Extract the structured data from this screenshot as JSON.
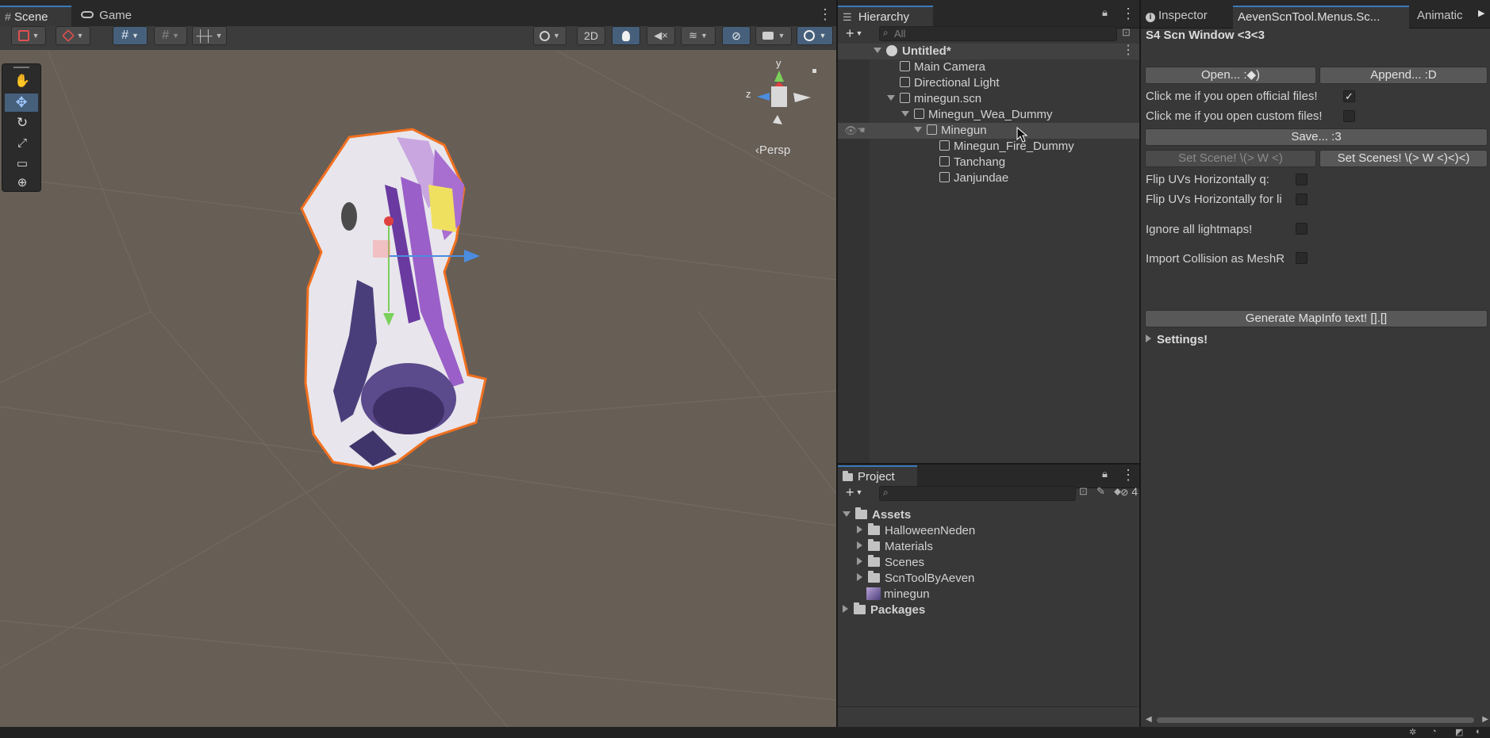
{
  "scene_window": {
    "tabs": [
      {
        "label": "Scene",
        "icon": "hash-icon"
      },
      {
        "label": "Game",
        "icon": "gamepad-icon"
      }
    ],
    "toolbar": {
      "mode_2d": "2D"
    },
    "tools": [
      "hand-tool",
      "move-tool",
      "rotate-tool",
      "scale-tool",
      "rect-tool",
      "transform-tool"
    ],
    "gizmo": {
      "axis_y": "y",
      "axis_z": "z",
      "projection": "‹Persp"
    },
    "colors": {
      "viewport_bg": "#665d55",
      "selection_outline": "#f07020",
      "accent": "#3a79bb"
    }
  },
  "hierarchy": {
    "title": "Hierarchy",
    "search_placeholder": "All",
    "items": [
      {
        "label": "Untitled*",
        "bold": true
      },
      {
        "label": "Main Camera"
      },
      {
        "label": "Directional Light"
      },
      {
        "label": "minegun.scn"
      },
      {
        "label": "Minegun_Wea_Dummy"
      },
      {
        "label": "Minegun",
        "selected": true
      },
      {
        "label": "Minegun_Fire_Dummy"
      },
      {
        "label": "Tanchang"
      },
      {
        "label": "Janjundae"
      }
    ]
  },
  "project": {
    "title": "Project",
    "hidden_count": "4",
    "items": [
      {
        "label": "Assets",
        "bold": true
      },
      {
        "label": "HalloweenNeden"
      },
      {
        "label": "Materials"
      },
      {
        "label": "Scenes"
      },
      {
        "label": "ScnToolByAeven"
      },
      {
        "label": "minegun"
      },
      {
        "label": "Packages",
        "bold": true
      }
    ]
  },
  "inspector": {
    "tabs": [
      {
        "label": "Inspector",
        "icon": "info-icon"
      },
      {
        "label": "AevenScnTool.Menus.Sc..."
      },
      {
        "label": "Animatic"
      }
    ],
    "window_title": "S4 Scn Window <3<3",
    "open_button": "Open... :◆)",
    "append_button": "Append... :D",
    "official_label": "Click me if you open official files!",
    "official_checked": true,
    "custom_label": "Click me if you open custom files!",
    "custom_checked": false,
    "save_button": "Save... :3",
    "set_scene_button": "Set Scene! \\(> W <)",
    "set_scenes_button": "Set Scenes! \\(> W <)<)<)",
    "flip_uv_label": "Flip UVs Horizontally q:",
    "flip_uv_li_label": "Flip UVs Horizontally for li",
    "ignore_lightmaps_label": "Ignore all lightmaps!",
    "import_collision_label": "Import Collision as MeshR",
    "generate_button": "Generate MapInfo text! [].[]",
    "settings_label": "Settings!"
  }
}
